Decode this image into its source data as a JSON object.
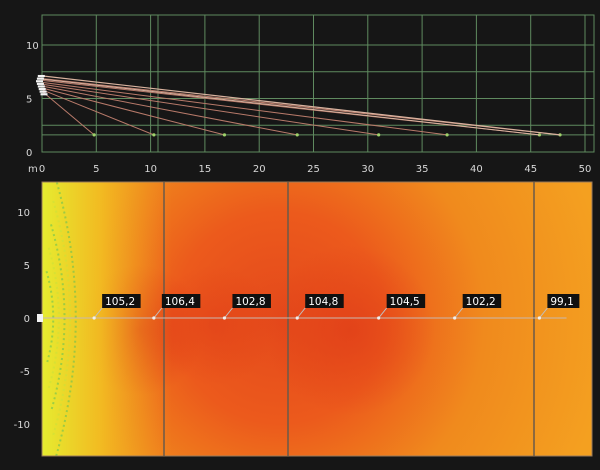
{
  "colors": {
    "background": "#161616",
    "grid": "#5f8a5f",
    "rays_main": "#d9b39f",
    "rays_secondary": "#b87a6a",
    "speaker": "#f3f3f3",
    "label_bg": "#101010",
    "label_text": "#ffffff",
    "axis_text": "#d8d8d8"
  },
  "section_view": {
    "y_axis_ticks": [
      "10",
      "5",
      "0"
    ],
    "x_axis_unit": "m",
    "x_axis_ticks": [
      "0",
      "5",
      "10",
      "15",
      "20",
      "25",
      "30",
      "35",
      "40",
      "45",
      "50"
    ]
  },
  "map_view": {
    "y_axis_ticks": [
      "10",
      "5",
      "0",
      "-5",
      "-10"
    ],
    "spl_labels": [
      {
        "x_m": 4.8,
        "value": "105,2"
      },
      {
        "x_m": 10.3,
        "value": "106,4"
      },
      {
        "x_m": 16.8,
        "value": "102,8"
      },
      {
        "x_m": 23.5,
        "value": "104,8"
      },
      {
        "x_m": 31.0,
        "value": "104,5"
      },
      {
        "x_m": 38.0,
        "value": "102,2"
      },
      {
        "x_m": 45.8,
        "value": "99,1"
      }
    ]
  }
}
